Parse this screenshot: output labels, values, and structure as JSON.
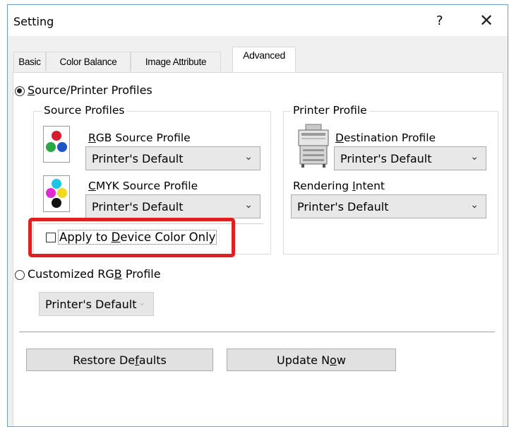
{
  "window": {
    "title": "Setting",
    "help_label": "?",
    "close_label": "✕"
  },
  "tabs": [
    {
      "label": "Basic"
    },
    {
      "label": "Color Balance"
    },
    {
      "label": "Image Attribute"
    },
    {
      "label": "Advanced"
    }
  ],
  "mode": {
    "source_printer": {
      "label_u": "S",
      "label_rest": "ource/Printer Profiles",
      "checked": true
    },
    "customized": {
      "label_pre": "Customized RG",
      "label_u": "B",
      "label_post": " Profile",
      "checked": false,
      "select_value": "Printer's Default"
    }
  },
  "source_profiles": {
    "title": "Source Profiles",
    "rgb": {
      "label_u": "R",
      "label_rest": "GB Source Profile",
      "value": "Printer's Default"
    },
    "cmyk": {
      "label_u": "C",
      "label_rest": "MYK Source Profile",
      "value": "Printer's Default"
    },
    "apply": {
      "label_pre": "Apply to ",
      "label_u": "D",
      "label_post": "evice Color Only",
      "checked": false
    }
  },
  "printer_profile": {
    "title": "Printer Profile",
    "destination": {
      "label_u": "D",
      "label_rest": "estination Profile",
      "value": "Printer's Default"
    },
    "rendering": {
      "label_pre": "Rendering ",
      "label_u": "I",
      "label_post": "ntent",
      "value": "Printer's Default"
    }
  },
  "buttons": {
    "restore": {
      "label_pre": "Restore De",
      "label_u": "f",
      "label_post": "aults"
    },
    "update": {
      "label_pre": "Update N",
      "label_u": "o",
      "label_post": "w"
    }
  },
  "colors": {
    "highlight": "#e02020",
    "window_border": "#6e9fd0"
  }
}
